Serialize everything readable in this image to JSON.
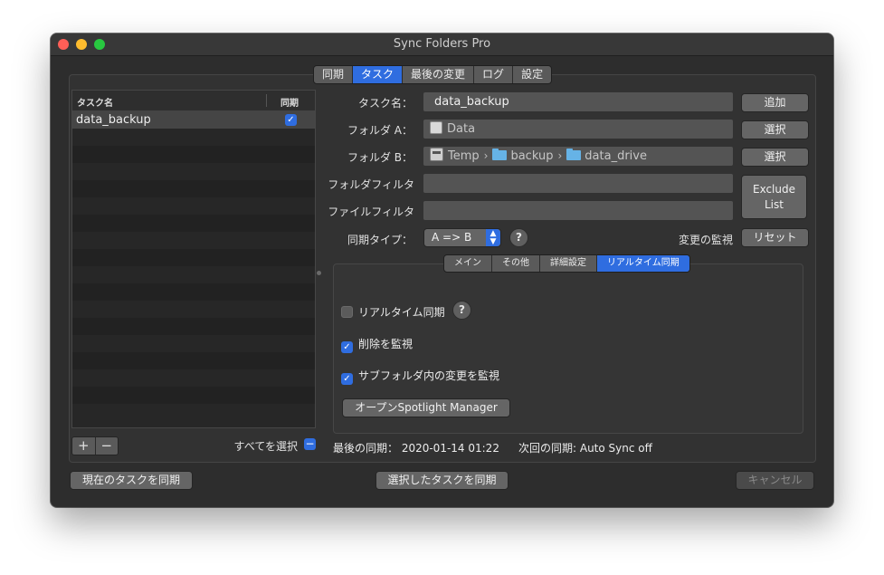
{
  "window": {
    "title": "Sync Folders Pro"
  },
  "main_tabs": [
    {
      "label": "同期",
      "active": false
    },
    {
      "label": "タスク",
      "active": true
    },
    {
      "label": "最後の変更",
      "active": false
    },
    {
      "label": "ログ",
      "active": false
    },
    {
      "label": "設定",
      "active": false
    }
  ],
  "tasklist": {
    "header_name": "タスク名",
    "header_sync": "同期",
    "rows": [
      {
        "name": "data_backup",
        "sync": true
      }
    ],
    "select_all_label": "すべてを選択"
  },
  "form": {
    "task_name_label": "タスク名：",
    "task_name_value": "data_backup",
    "add_button": "追加",
    "folder_a_label": "フォルダ A：",
    "folder_a_path": "Data",
    "folder_b_label": "フォルダ B：",
    "folder_b_path": [
      "Temp",
      "backup",
      "data_drive"
    ],
    "select_button": "選択",
    "folder_filter_label": "フォルダフィルタ",
    "file_filter_label": "ファイルフィルタ",
    "folder_filter_value": "",
    "file_filter_value": "",
    "exclude_list_button_line1": "Exclude",
    "exclude_list_button_line2": "List",
    "sync_type_label": "同期タイプ：",
    "sync_type_value": "A => B",
    "watch_changes_label": "変更の監視",
    "reset_button": "リセット"
  },
  "sub_tabs": [
    {
      "label": "メイン",
      "active": false
    },
    {
      "label": "その他",
      "active": false
    },
    {
      "label": "詳細設定",
      "active": false
    },
    {
      "label": "リアルタイム同期",
      "active": true
    }
  ],
  "realtime": {
    "realtime_sync_label": "リアルタイム同期",
    "realtime_sync_checked": false,
    "watch_delete_label": "削除を監視",
    "watch_delete_checked": true,
    "watch_subfolder_label": "サブフォルダ内の変更を監視",
    "watch_subfolder_checked": true,
    "spotlight_button": "オープンSpotlight Manager"
  },
  "status": {
    "last_sync": "最後の同期： 2020-01-14 01:22",
    "next_sync": "次回の同期: Auto Sync off"
  },
  "footer": {
    "sync_current_button": "現在のタスクを同期",
    "sync_selected_button": "選択したタスクを同期",
    "cancel_button": "キャンセル"
  },
  "icons": {
    "help": "?",
    "checkmark": "✓",
    "breadcrumb_separator": "›",
    "plus": "+",
    "minus": "−",
    "popup_arrows_up": "▲",
    "popup_arrows_down": "▼"
  },
  "colors": {
    "accent": "#2f6de0",
    "window_bg": "#2d2d2d"
  }
}
